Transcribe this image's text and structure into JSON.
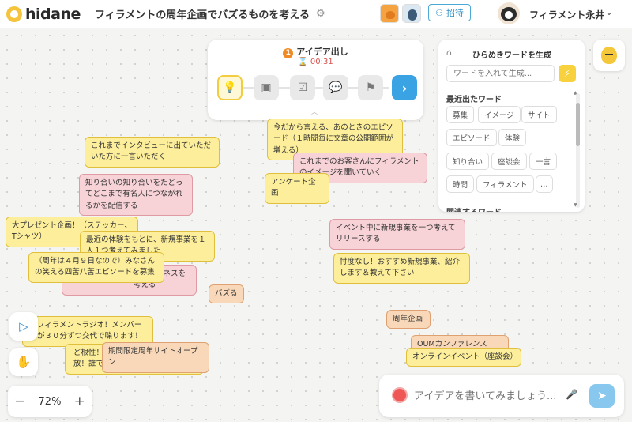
{
  "header": {
    "logo_text": "hidane",
    "board_title": "フィラメントの周年企画でバズるものを考える",
    "invite_label": "招待",
    "user_name": "フィラメント永井"
  },
  "step_panel": {
    "step_number": "1",
    "step_title": "アイデア出し",
    "timer": "00:31"
  },
  "word_panel": {
    "title": "ひらめきワードを生成",
    "input_placeholder": "ワードを入れて生成...",
    "recent_label": "最近出たワード",
    "related_label": "関連するワード",
    "chips": [
      "募集",
      "イメージ",
      "サイト",
      "エピソード",
      "体験",
      "知り合い",
      "座談会",
      "一言",
      "時間",
      "フィラメント",
      "…"
    ]
  },
  "stickies": [
    {
      "text": "今だから言える、あのときのエピソード（１時間毎に文章の公開範囲が増える）",
      "color": "yellow"
    },
    {
      "text": "これまでインタビューに出ていただいた方に一言いただく",
      "color": "yellow"
    },
    {
      "text": "これまでのお客さんにフィラメントのイメージを聞いていく",
      "color": "pink"
    },
    {
      "text": "アンケート企画",
      "color": "yellow"
    },
    {
      "text": "知り合いの知り合いをたどってどこまで有名人につながれるかを配信する",
      "color": "pink"
    },
    {
      "text": "大プレゼント企画！（ステッカー、Tシャツ）",
      "color": "yellow"
    },
    {
      "text": "最近の体験をもとに、新規事業を１人１つ考えてみました",
      "color": "yellow"
    },
    {
      "text": "イベント中に新規事業を一つ考えてリリースする",
      "color": "pink"
    },
    {
      "text": "（周年は４月９日なので）みなさんの笑える四苦八苦エピソードを募集",
      "color": "yellow"
    },
    {
      "text": "えてビジネスを考える",
      "color": "pink"
    },
    {
      "text": "忖度なし！おすすめ新規事業、紹介します＆教えて下さい",
      "color": "yellow"
    },
    {
      "text": "バズる",
      "color": "orange"
    },
    {
      "text": "フィラメントラジオ！メンバーが３０分ずつ交代で喋ります！",
      "color": "yellow"
    },
    {
      "text": "周年企画",
      "color": "orange"
    },
    {
      "text": "ど根性！",
      "color": "yellow"
    },
    {
      "text": "期間限定周年サイトオープン",
      "color": "orange"
    },
    {
      "text": "放！誰でも遊びに来てね！！",
      "color": "yellow"
    },
    {
      "text": "OUMカンファレンス2022",
      "color": "orange"
    },
    {
      "text": "オンラインイベント（座談会）",
      "color": "yellow"
    }
  ],
  "zoom": {
    "minus": "−",
    "level": "72%",
    "plus": "+"
  },
  "idea_input": {
    "placeholder": "アイデアを書いてみましょう..."
  }
}
